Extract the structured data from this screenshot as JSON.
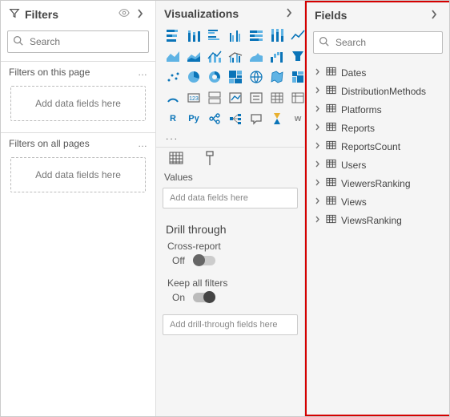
{
  "filters": {
    "title": "Filters",
    "search_placeholder": "Search",
    "section_page": "Filters on this page",
    "section_all": "Filters on all pages",
    "drop_hint": "Add data fields here"
  },
  "visualizations": {
    "title": "Visualizations",
    "icons": [
      "stacked-bar",
      "stacked-column",
      "clustered-bar",
      "clustered-column",
      "100-stacked-bar",
      "100-stacked-column",
      "line",
      "area",
      "stacked-area",
      "line-column",
      "line-clustered",
      "ribbon",
      "waterfall",
      "funnel",
      "scatter",
      "pie",
      "donut",
      "treemap",
      "map",
      "filled-map",
      "shape-map",
      "gauge",
      "card",
      "multi-row-card",
      "kpi",
      "slicer",
      "table",
      "matrix",
      "r-visual",
      "py-visual",
      "key-influencers",
      "decomp-tree",
      "qa",
      "paginated",
      "word"
    ],
    "more": "...",
    "wells_section": "Values",
    "drop_hint": "Add data fields here",
    "drill_title": "Drill through",
    "cross_report_label": "Cross-report",
    "cross_report_value": "Off",
    "keep_filters_label": "Keep all filters",
    "keep_filters_value": "On",
    "drill_drop_hint": "Add drill-through fields here"
  },
  "fields": {
    "title": "Fields",
    "search_placeholder": "Search",
    "tables": [
      "Dates",
      "DistributionMethods",
      "Platforms",
      "Reports",
      "ReportsCount",
      "Users",
      "ViewersRanking",
      "Views",
      "ViewsRanking"
    ]
  }
}
